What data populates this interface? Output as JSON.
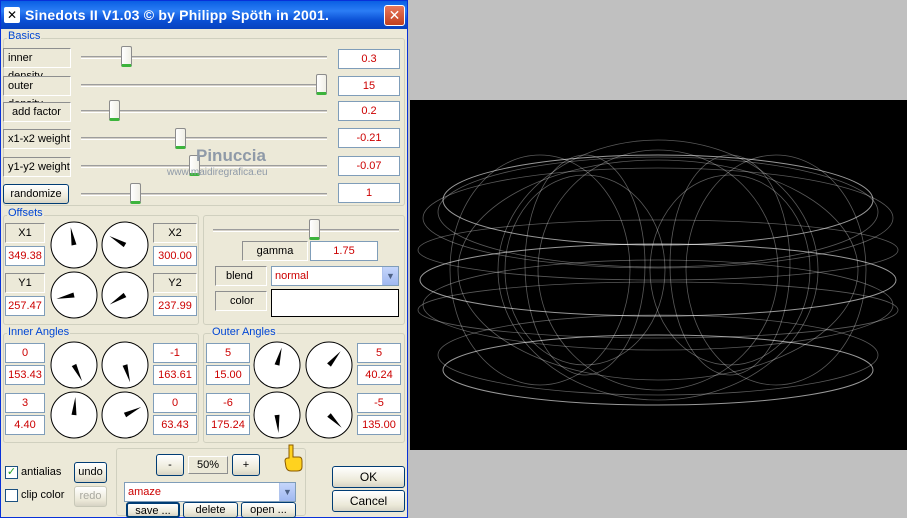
{
  "window": {
    "title": "Sinedots II V1.03 © by Philipp Spöth in 2001.",
    "close_glyph": "✕",
    "icon_glyph": "✕"
  },
  "basics": {
    "label": "Basics",
    "rows": [
      {
        "label": "inner density",
        "value": "0.3",
        "slider": 0.17
      },
      {
        "label": "outer density",
        "value": "15",
        "slider": 1.0
      },
      {
        "label": "add factor",
        "value": "0.2",
        "slider": 0.12
      },
      {
        "label": "x1-x2 weight",
        "value": "-0.21",
        "slider": 0.4
      },
      {
        "label": "y1-y2 weight",
        "value": "-0.07",
        "slider": 0.46
      },
      {
        "label": "randomize",
        "value": "1",
        "slider": 0.21
      }
    ]
  },
  "offsets": {
    "label": "Offsets",
    "x1": {
      "label": "X1",
      "value": "349.38"
    },
    "x2": {
      "label": "X2",
      "value": "300.00"
    },
    "y1": {
      "label": "Y1",
      "value": "257.47"
    },
    "y2": {
      "label": "Y2",
      "value": "237.99"
    },
    "dial_angles": [
      349.38,
      300.0,
      257.47,
      237.99
    ]
  },
  "rendering": {
    "gamma_label": "gamma",
    "gamma_value": "1.75",
    "gamma_slider": 0.55,
    "blend_label": "blend",
    "blend_value": "normal",
    "color_label": "color",
    "color_value": "#ffffff"
  },
  "inner_angles": {
    "label": "Inner Angles",
    "top_left": {
      "step": "0",
      "angle": "153.43"
    },
    "top_right": {
      "step": "-1",
      "angle": "163.61"
    },
    "bottom_left": {
      "step": "3",
      "angle": "4.40"
    },
    "bottom_right": {
      "step": "0",
      "angle": "63.43"
    },
    "dial_angles": [
      153.43,
      163.61,
      4.4,
      63.43
    ]
  },
  "outer_angles": {
    "label": "Outer Angles",
    "top_left": {
      "step": "5",
      "angle": "15.00"
    },
    "top_right": {
      "step": "5",
      "angle": "40.24"
    },
    "bottom_left": {
      "step": "-6",
      "angle": "175.24"
    },
    "bottom_right": {
      "step": "-5",
      "angle": "135.00"
    },
    "dial_angles": [
      15.0,
      40.24,
      175.24,
      135.0
    ]
  },
  "options": {
    "antialias_label": "antialias",
    "antialias_checked": true,
    "clip_color_label": "clip color",
    "clip_color_checked": false,
    "undo_label": "undo",
    "redo_label": "redo"
  },
  "zoom": {
    "minus_label": "-",
    "value": "50%",
    "plus_label": "+"
  },
  "presets": {
    "selected": "amaze",
    "save_label": "save ...",
    "delete_label": "delete",
    "open_label": "open ..."
  },
  "dialog": {
    "ok_label": "OK",
    "cancel_label": "Cancel"
  },
  "watermark": {
    "logo": "Pinuccia",
    "url": "www.maidiregrafica.eu"
  }
}
